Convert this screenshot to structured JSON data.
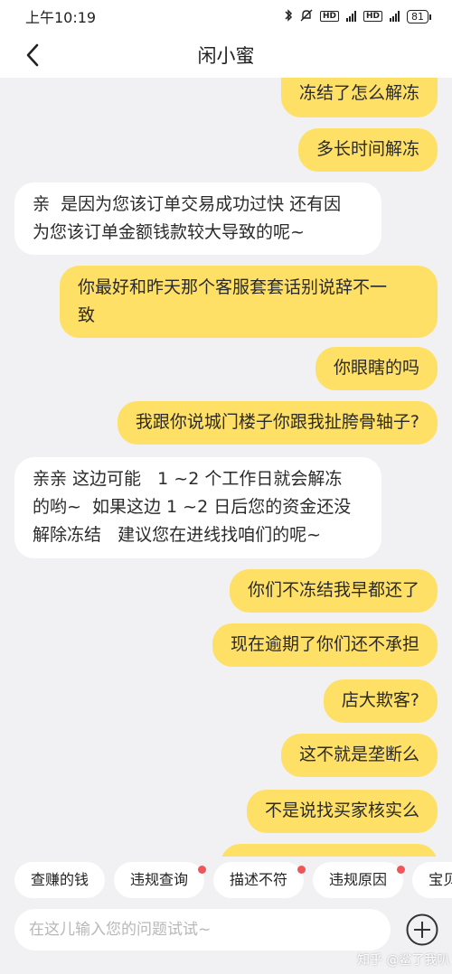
{
  "status_bar": {
    "time": "上午10:19",
    "battery": "81",
    "net1": "HD",
    "net2": "HD"
  },
  "header": {
    "title": "闲小蜜"
  },
  "messages": [
    {
      "from": "me",
      "text": "冻结了怎么解冻"
    },
    {
      "from": "me",
      "text": "多长时间解冻"
    },
    {
      "from": "bot",
      "text": "亲  是因为您该订单交易成功过快 还有因\n为您该订单金额钱款较大导致的呢~"
    },
    {
      "from": "me",
      "text": "你最好和昨天那个客服套套话别说辞不一\n致"
    },
    {
      "from": "me",
      "text": "你眼瞎的吗"
    },
    {
      "from": "me",
      "text": "我跟你说城门楼子你跟我扯胯骨轴子?"
    },
    {
      "from": "bot",
      "text": "亲亲 这边可能   1 ~2 个工作日就会解冻\n的哟~  如果这边 1 ~2 日后您的资金还没\n解除冻结   建议您在进线找咱们的呢~"
    },
    {
      "from": "me",
      "text": "你们不冻结我早都还了"
    },
    {
      "from": "me",
      "text": "现在逾期了你们还不承担"
    },
    {
      "from": "me",
      "text": "店大欺客?"
    },
    {
      "from": "me",
      "text": "这不就是垄断么"
    },
    {
      "from": "me",
      "text": "不是说找买家核实么"
    }
  ],
  "quick_replies": [
    {
      "label": "查赚的钱",
      "dot": false
    },
    {
      "label": "违规查询",
      "dot": true
    },
    {
      "label": "描述不符",
      "dot": true
    },
    {
      "label": "违规原因",
      "dot": true
    },
    {
      "label": "宝贝",
      "dot": false
    }
  ],
  "input": {
    "placeholder": "在这儿输入您的问题试试~"
  },
  "watermark": "知乎 @鲨了我叭"
}
